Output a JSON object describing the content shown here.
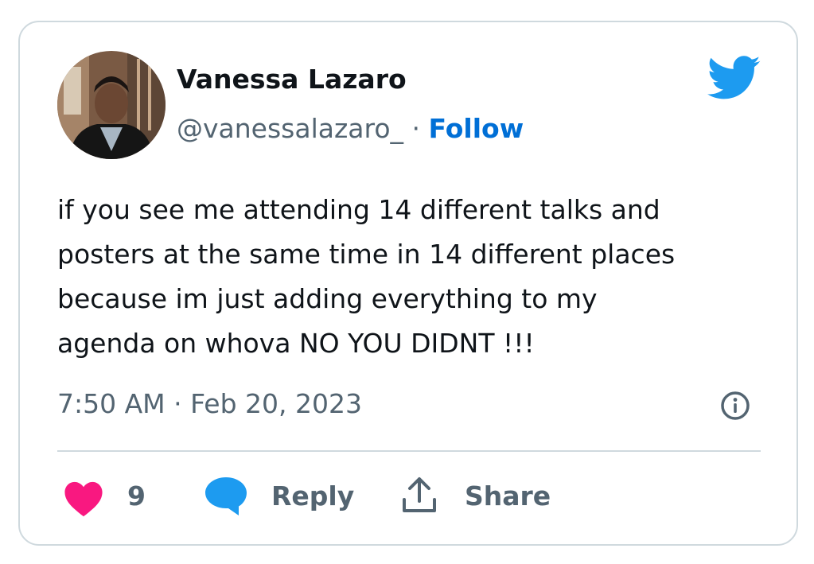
{
  "tweet": {
    "author_name": "Vanessa Lazaro",
    "handle": "@vanessalazaro_",
    "separator": "·",
    "follow_label": "Follow",
    "text": "if you see me attending 14 different talks and\nposters at the same time in 14 different places\nbecause im just adding everything to my\nagenda on whova NO YOU DIDNT !!!",
    "timestamp": "7:50 AM · Feb 20, 2023"
  },
  "actions": {
    "like_count": "9",
    "reply_label": "Reply",
    "share_label": "Share"
  },
  "icons": {
    "brand": "twitter-bird-icon",
    "info": "info-icon",
    "like": "heart-icon",
    "reply": "speech-bubble-icon",
    "share": "share-upload-icon"
  },
  "colors": {
    "brand_blue": "#1d9bf0",
    "follow_blue": "#006fd6",
    "heart_pink": "#f91880",
    "text_primary": "#0f1419",
    "text_secondary": "#536471",
    "border": "#cfd9de"
  }
}
